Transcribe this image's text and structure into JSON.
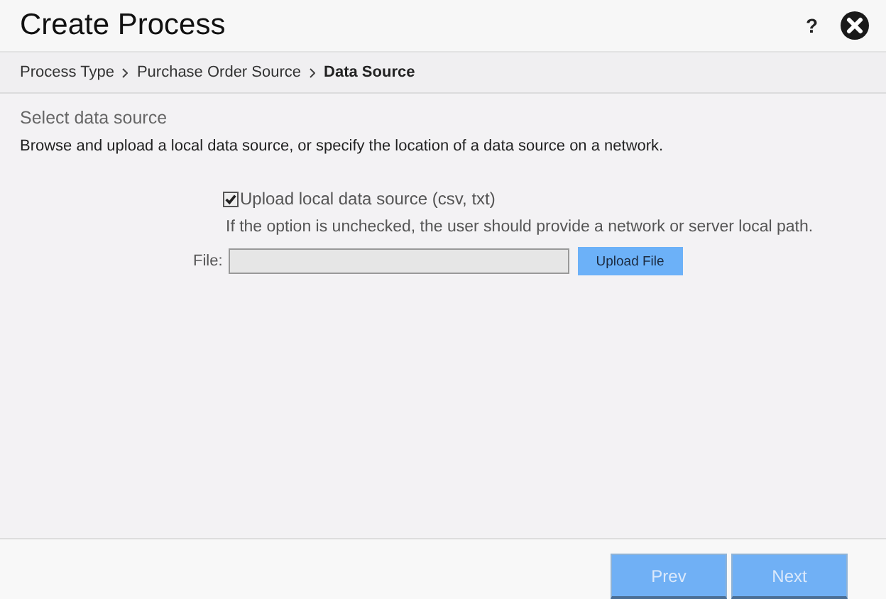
{
  "window": {
    "title": "Create Process",
    "help": "?"
  },
  "breadcrumb": [
    {
      "label": "Process Type",
      "selected": false
    },
    {
      "label": "Purchase Order Source",
      "selected": false
    },
    {
      "label": "Data Source",
      "selected": true
    }
  ],
  "section_title": "Select data source",
  "description": "Browse and upload a local data source, or specify the location of a data source on a network.",
  "upload_option": {
    "label": "Upload local data source (csv, txt)",
    "checked": true,
    "hint": "If the option is unchecked, the user should provide a network or server local path."
  },
  "file": {
    "label": "File:",
    "button": "Upload File"
  },
  "buttons": [
    "Prev",
    "Next"
  ]
}
